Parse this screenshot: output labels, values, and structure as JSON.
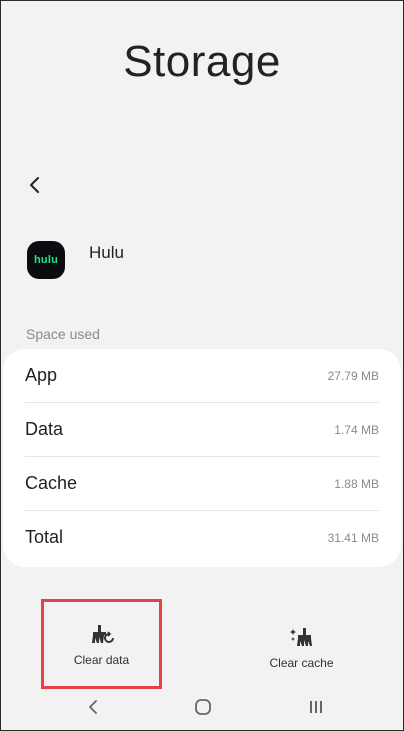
{
  "header": {
    "title": "Storage"
  },
  "app": {
    "name": "Hulu",
    "icon_text": "hulu",
    "icon_color": "#1ce783"
  },
  "space_used": {
    "label": "Space used",
    "rows": [
      {
        "label": "App",
        "value": "27.79 MB"
      },
      {
        "label": "Data",
        "value": "1.74 MB"
      },
      {
        "label": "Cache",
        "value": "1.88 MB"
      },
      {
        "label": "Total",
        "value": "31.41 MB"
      }
    ]
  },
  "actions": {
    "clear_data": "Clear data",
    "clear_cache": "Clear cache"
  },
  "icons": {
    "back": "back-arrow-icon",
    "clear_data": "broom-clear-data-icon",
    "clear_cache": "broom-sparkle-icon",
    "nav_back": "nav-back-icon",
    "nav_home": "nav-home-icon",
    "nav_recents": "nav-recents-icon"
  },
  "colors": {
    "highlight": "#e8414a",
    "background": "#f2f2f2"
  }
}
